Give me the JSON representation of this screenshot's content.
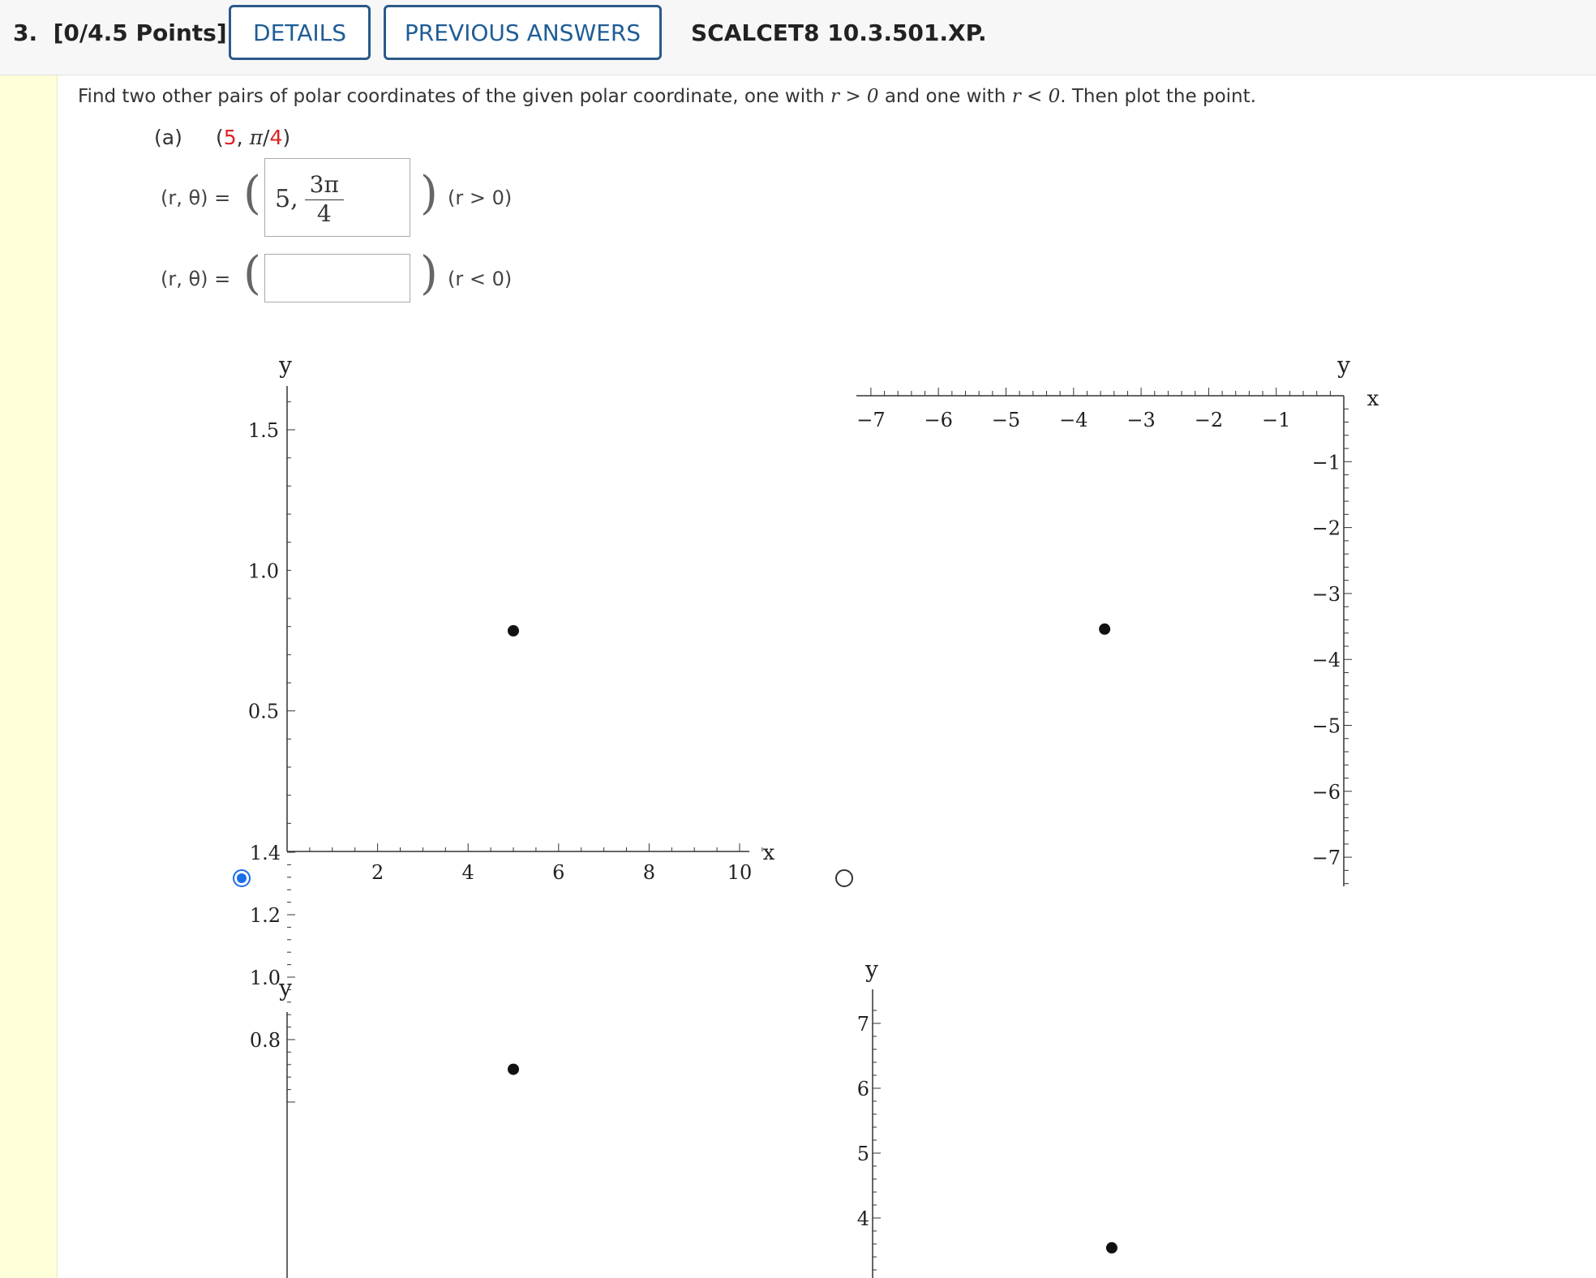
{
  "header": {
    "question_number": "3.",
    "points": "[0/4.5 Points]",
    "details_label": "DETAILS",
    "previous_answers_label": "PREVIOUS ANSWERS",
    "question_code": "SCALCET8 10.3.501.XP."
  },
  "question": {
    "prompt_part1": "Find two other pairs of polar coordinates of the given polar coordinate, one with ",
    "cond_pos": "r > 0",
    "prompt_part2": " and one with ",
    "cond_neg": "r < 0",
    "prompt_part3": ". Then plot the point.",
    "part_label": "(a)",
    "given_open": "(",
    "given_r": "5",
    "given_sep": ", ",
    "given_pi": "π",
    "given_slash": "/",
    "given_den": "4",
    "given_close": ")"
  },
  "answers": [
    {
      "label": "(r, θ) =",
      "value_r": "5,",
      "value_num": "3π",
      "value_den": "4",
      "condition": "(r > 0)"
    },
    {
      "label": "(r, θ) =",
      "value_r": "",
      "value_num": "",
      "value_den": "",
      "condition": "(r < 0)"
    }
  ],
  "graph_options": [
    {
      "selected": true
    },
    {
      "selected": false
    }
  ],
  "chart_data": [
    {
      "type": "scatter",
      "xlabel": "x",
      "ylabel": "y",
      "xlim": [
        0,
        10.5
      ],
      "ylim": [
        0,
        1.65
      ],
      "x_ticks": [
        "2",
        "4",
        "6",
        "8",
        "10"
      ],
      "y_ticks": [
        "0.5",
        "1.0",
        "1.5"
      ],
      "points": [
        {
          "x": 5,
          "y": 0.785
        }
      ]
    },
    {
      "type": "scatter",
      "xlabel": "x",
      "ylabel": "y",
      "xlim": [
        -7.1,
        0
      ],
      "ylim": [
        -7.4,
        0
      ],
      "x_ticks": [
        "−7",
        "−6",
        "−5",
        "−4",
        "−3",
        "−2",
        "−1"
      ],
      "y_ticks": [
        "−1",
        "−2",
        "−3",
        "−4",
        "−5",
        "−6",
        "−7"
      ],
      "points": [
        {
          "x": -3.54,
          "y": -3.54
        }
      ]
    },
    {
      "type": "scatter",
      "xlabel": "",
      "ylabel": "y",
      "xlim": [
        0,
        10.5
      ],
      "ylim": [
        0.58,
        1.44
      ],
      "x_ticks": [],
      "y_ticks": [
        "0.8",
        "1.0",
        "1.2",
        "1.4"
      ],
      "points": [
        {
          "x": 5,
          "y": 0.705
        }
      ]
    },
    {
      "type": "scatter",
      "xlabel": "",
      "ylabel": "y",
      "xlim": [
        0,
        7.2
      ],
      "ylim": [
        2.9,
        7.3
      ],
      "x_ticks": [],
      "y_ticks": [
        "4",
        "5",
        "6",
        "7"
      ],
      "points": [
        {
          "x": 3.54,
          "y": 3.54
        }
      ]
    }
  ]
}
